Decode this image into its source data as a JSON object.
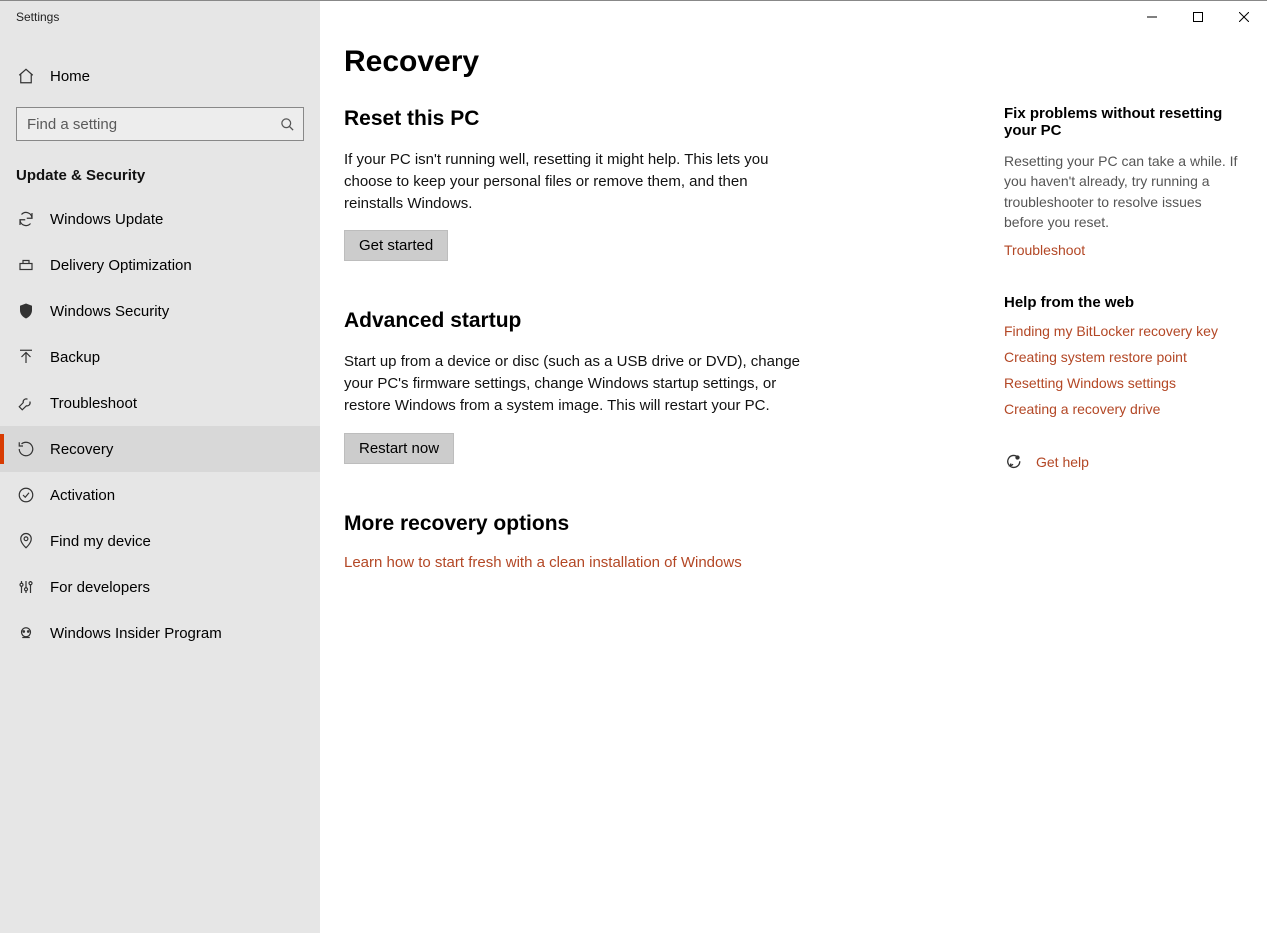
{
  "window": {
    "title": "Settings"
  },
  "sidebar": {
    "home": "Home",
    "search_placeholder": "Find a setting",
    "section": "Update & Security",
    "items": [
      {
        "label": "Windows Update"
      },
      {
        "label": "Delivery Optimization"
      },
      {
        "label": "Windows Security"
      },
      {
        "label": "Backup"
      },
      {
        "label": "Troubleshoot"
      },
      {
        "label": "Recovery"
      },
      {
        "label": "Activation"
      },
      {
        "label": "Find my device"
      },
      {
        "label": "For developers"
      },
      {
        "label": "Windows Insider Program"
      }
    ]
  },
  "page": {
    "title": "Recovery",
    "reset": {
      "heading": "Reset this PC",
      "body": "If your PC isn't running well, resetting it might help. This lets you choose to keep your personal files or remove them, and then reinstalls Windows.",
      "button": "Get started"
    },
    "advanced": {
      "heading": "Advanced startup",
      "body": "Start up from a device or disc (such as a USB drive or DVD), change your PC's firmware settings, change Windows startup settings, or restore Windows from a system image. This will restart your PC.",
      "button": "Restart now"
    },
    "more": {
      "heading": "More recovery options",
      "link": "Learn how to start fresh with a clean installation of Windows"
    }
  },
  "aside": {
    "fix": {
      "heading": "Fix problems without resetting your PC",
      "body": "Resetting your PC can take a while. If you haven't already, try running a troubleshooter to resolve issues before you reset.",
      "link": "Troubleshoot"
    },
    "help": {
      "heading": "Help from the web",
      "links": [
        "Finding my BitLocker recovery key",
        "Creating system restore point",
        "Resetting Windows settings",
        "Creating a recovery drive"
      ]
    },
    "gethelp": "Get help"
  }
}
